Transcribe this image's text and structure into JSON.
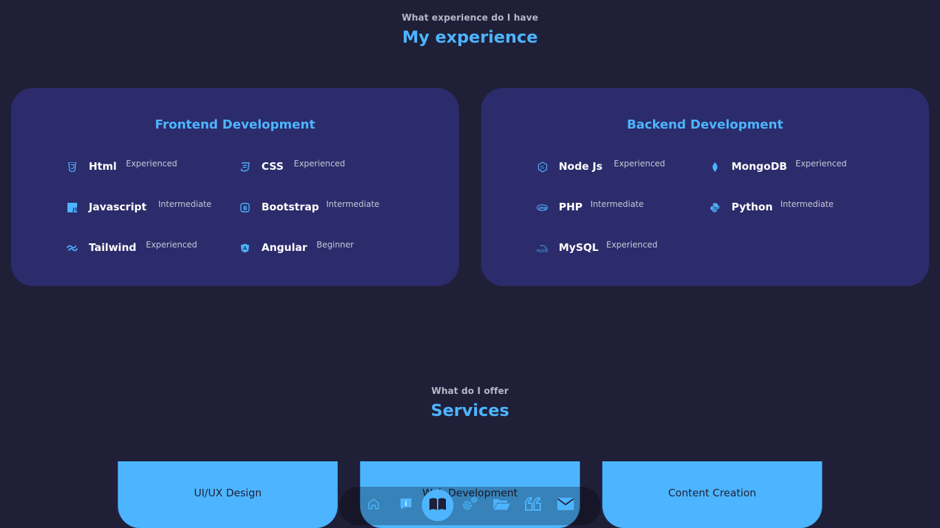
{
  "experience_section": {
    "eyebrow": "What experience do I have",
    "title": "My experience"
  },
  "frontend": {
    "title": "Frontend Development",
    "skills": [
      {
        "name": "Html",
        "level": "Experienced",
        "icon": "html5-icon"
      },
      {
        "name": "CSS",
        "level": "Experienced",
        "icon": "css3-icon"
      },
      {
        "name": "Javascript",
        "level": "Intermediate",
        "icon": "javascript-icon"
      },
      {
        "name": "Bootstrap",
        "level": "Intermediate",
        "icon": "bootstrap-icon"
      },
      {
        "name": "Tailwind",
        "level": "Experienced",
        "icon": "tailwind-icon"
      },
      {
        "name": "Angular",
        "level": "Beginner",
        "icon": "angular-icon"
      }
    ]
  },
  "backend": {
    "title": "Backend Development",
    "skills": [
      {
        "name": "Node Js",
        "level": "Experienced",
        "icon": "nodejs-icon"
      },
      {
        "name": "MongoDB",
        "level": "Experienced",
        "icon": "mongodb-icon"
      },
      {
        "name": "PHP",
        "level": "Intermediate",
        "icon": "php-icon"
      },
      {
        "name": "Python",
        "level": "Intermediate",
        "icon": "python-icon"
      },
      {
        "name": "MySQL",
        "level": "Experienced",
        "icon": "mysql-icon"
      }
    ]
  },
  "services_section": {
    "eyebrow": "What do I offer",
    "title": "Services",
    "items": [
      {
        "title": "UI/UX Design"
      },
      {
        "title": "Web Development"
      },
      {
        "title": "Content Creation"
      }
    ]
  },
  "nav": {
    "items": [
      {
        "icon": "home-icon",
        "active": false
      },
      {
        "icon": "about-icon",
        "active": false
      },
      {
        "icon": "book-icon",
        "active": true
      },
      {
        "icon": "gears-icon",
        "active": false
      },
      {
        "icon": "folder-icon",
        "active": false
      },
      {
        "icon": "quote-icon",
        "active": false
      },
      {
        "icon": "envelope-icon",
        "active": false
      }
    ]
  },
  "colors": {
    "background": "#1f1f38",
    "card": "#2c2c6c",
    "accent": "#4db5ff"
  }
}
